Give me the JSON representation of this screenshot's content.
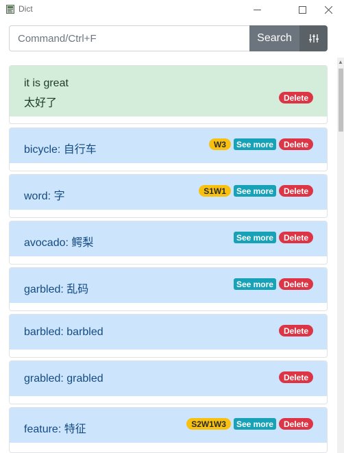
{
  "window": {
    "title": "Dict",
    "min_glyph": "—",
    "max_glyph": "☐",
    "close_glyph": "✕"
  },
  "search": {
    "placeholder": "Command/Ctrl+F",
    "button_label": "Search",
    "filter_icon": "sliders-icon"
  },
  "entries": [
    {
      "style": "success",
      "line1": "it is great",
      "line2": "太好了",
      "tag": null,
      "see_more": false,
      "delete_label": "Delete"
    },
    {
      "style": "info",
      "text": "bicycle: 自行车",
      "tag": "W3",
      "see_more": true,
      "see_more_label": "See more",
      "delete_label": "Delete"
    },
    {
      "style": "info",
      "text": "word: 字",
      "tag": "S1W1",
      "see_more": true,
      "see_more_label": "See more",
      "delete_label": "Delete"
    },
    {
      "style": "info",
      "text": "avocado: 鳄梨",
      "tag": null,
      "see_more": true,
      "see_more_label": "See more",
      "delete_label": "Delete"
    },
    {
      "style": "info",
      "text": "garbled: 乱码",
      "tag": null,
      "see_more": true,
      "see_more_label": "See more",
      "delete_label": "Delete"
    },
    {
      "style": "info",
      "text": "barbled: barbled",
      "tag": null,
      "see_more": false,
      "delete_label": "Delete"
    },
    {
      "style": "info",
      "text": "grabled: grabled",
      "tag": null,
      "see_more": false,
      "delete_label": "Delete"
    },
    {
      "style": "info",
      "text": "feature: 特征",
      "tag": "S2W1W3",
      "see_more": true,
      "see_more_label": "See more",
      "delete_label": "Delete"
    }
  ],
  "colors": {
    "success_bg": "#d4eddb",
    "info_bg": "#cce5fc",
    "tag_yellow": "#f8c110",
    "see_more_teal": "#17a2b8",
    "delete_red": "#dc3545",
    "search_btn": "#6c757d"
  }
}
